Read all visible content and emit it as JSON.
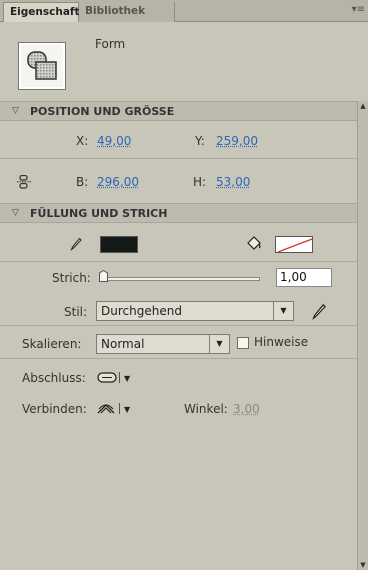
{
  "tabs": {
    "properties": "Eigenschaften",
    "library": "Bibliothek",
    "menu": "▾≡"
  },
  "header": {
    "object_type": "Form"
  },
  "position_size": {
    "title": "POSITION UND GRÖSSE",
    "x_label": "X:",
    "x_value": "49,00",
    "y_label": "Y:",
    "y_value": "259,00",
    "w_label": "B:",
    "w_value": "296,00",
    "h_label": "H:",
    "h_value": "53,00"
  },
  "fill_stroke": {
    "title": "FÜLLUNG UND STRICH",
    "fill_color": "#141a18",
    "stroke_label": "Strich:",
    "stroke_value": "1,00",
    "stroke_slider_fraction": 0.0,
    "style_label": "Stil:",
    "style_value": "Durchgehend",
    "scale_label": "Skalieren:",
    "scale_value": "Normal",
    "hints_label": "Hinweise",
    "hints_checked": false,
    "cap_label": "Abschluss:",
    "join_label": "Verbinden:",
    "miter_label": "Winkel:",
    "miter_value": "3,00"
  },
  "icons": {
    "thumbnail": "shape-thumbnail-icon",
    "link": "link-constrain-icon",
    "fill_tool": "pencil-icon",
    "stroke_tool": "paint-bucket-icon",
    "style_edit": "pencil-icon",
    "cap": "round-cap-icon",
    "join": "round-join-icon"
  }
}
